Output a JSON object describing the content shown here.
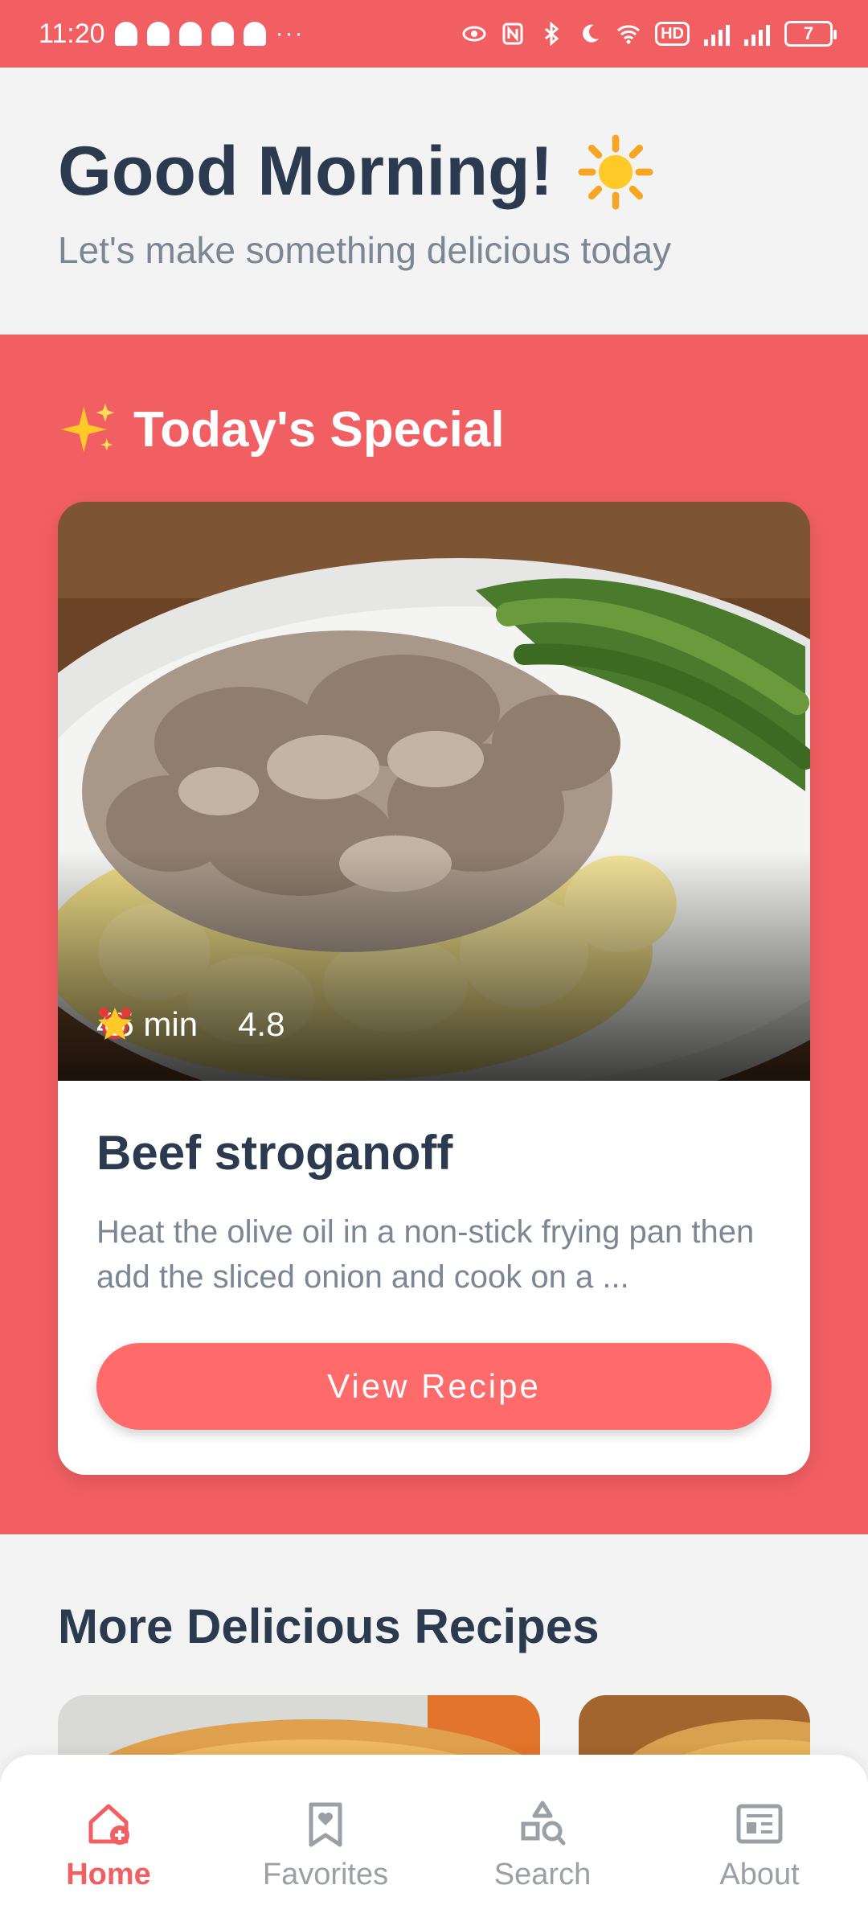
{
  "status_bar": {
    "time": "11:20",
    "dots": "···",
    "hd_label": "HD",
    "battery": "7"
  },
  "header": {
    "greeting": "Good Morning!",
    "subtitle": "Let's make something delicious today",
    "greeting_icon": "sun-icon"
  },
  "special": {
    "section_title": "Today's Special",
    "section_icon": "sparkles-icon",
    "recipe": {
      "name": "Beef stroganoff",
      "description": "Heat the olive oil in a non-stick frying pan then add the sliced onion and cook on a ...",
      "time": "45 min",
      "rating": "4.8",
      "button_label": "View Recipe"
    }
  },
  "more": {
    "title": "More Delicious Recipes"
  },
  "nav": {
    "items": [
      {
        "label": "Home",
        "icon": "home-icon",
        "active": true
      },
      {
        "label": "Favorites",
        "icon": "favorites-icon",
        "active": false
      },
      {
        "label": "Search",
        "icon": "search-icon",
        "active": false
      },
      {
        "label": "About",
        "icon": "about-icon",
        "active": false
      }
    ]
  },
  "colors": {
    "accent": "#f25f63",
    "button": "#ff6b6b",
    "heading": "#2b3a4e",
    "muted": "#7b8794"
  }
}
